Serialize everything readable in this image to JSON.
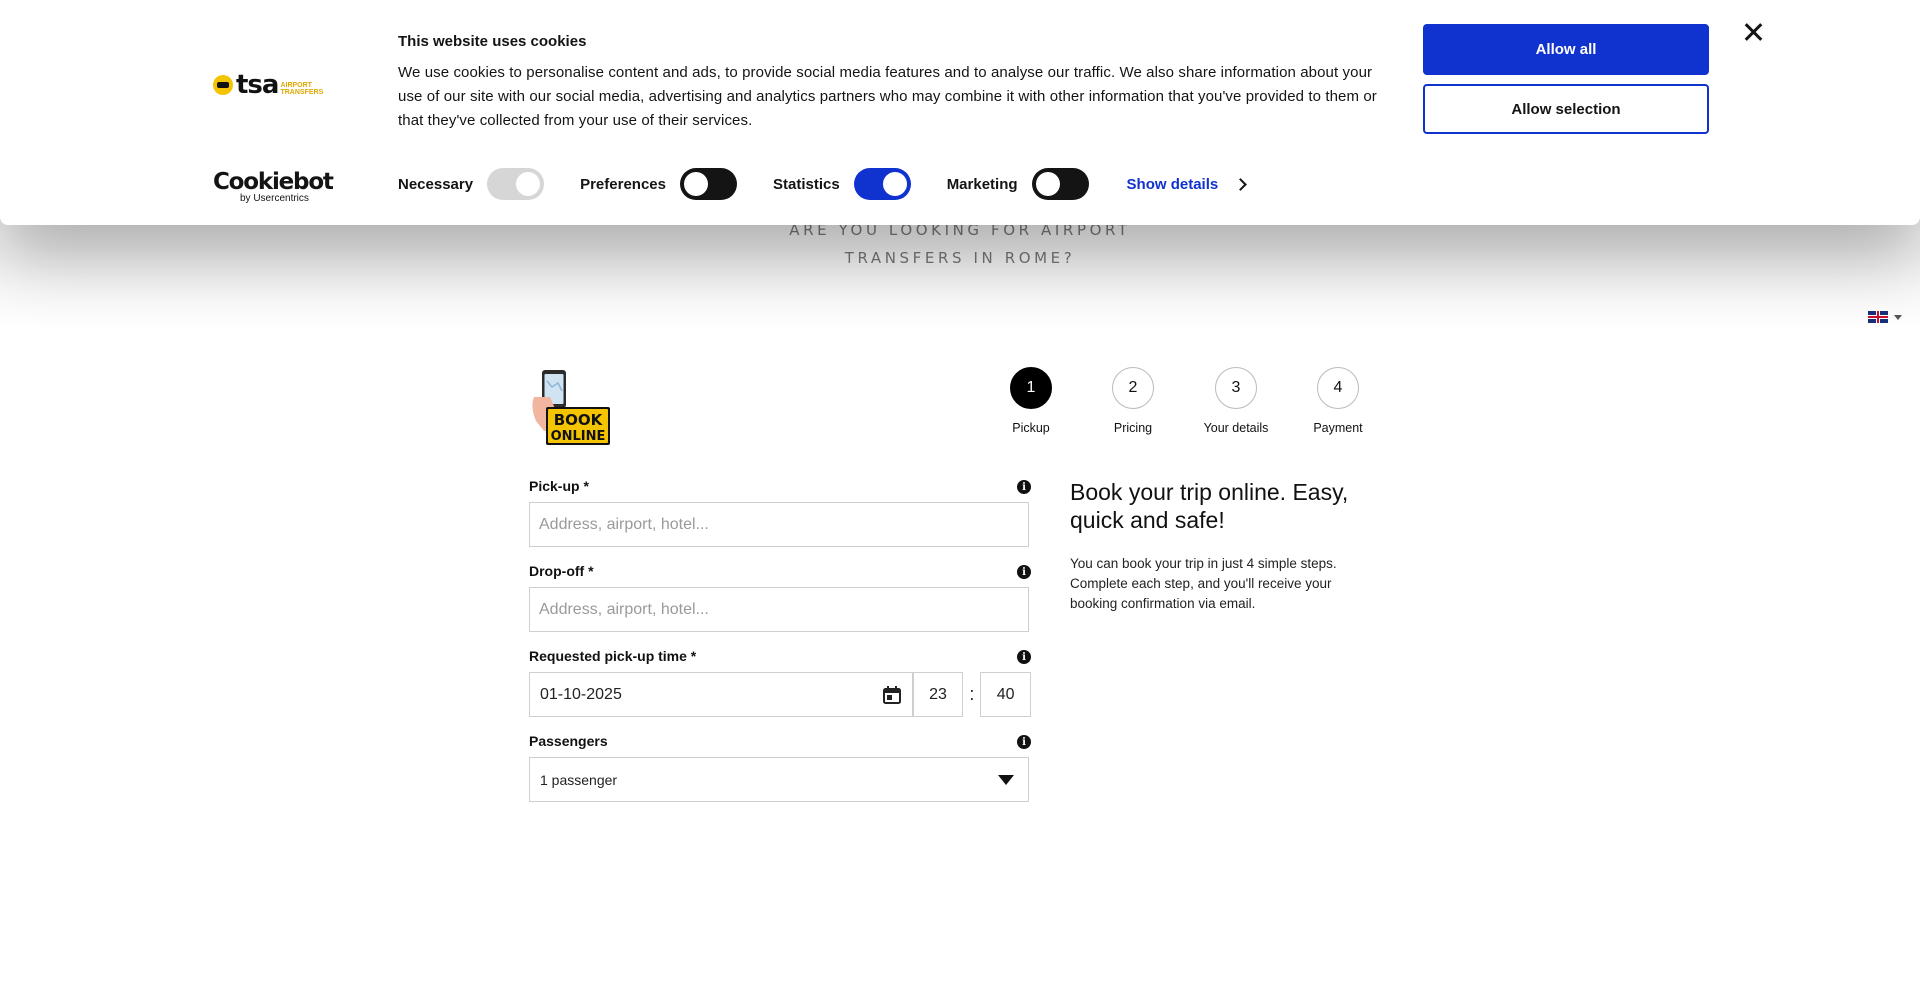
{
  "cookie_banner": {
    "title": "This website uses cookies",
    "text": "We use cookies to personalise content and ads, to provide social media features and to analyse our traffic. We also share information about your use of our site with our social media, advertising and analytics partners who may combine it with other information that you've provided to them or that they've collected from your use of their services.",
    "toggles": [
      {
        "label": "Necessary",
        "state": "on-disabled"
      },
      {
        "label": "Preferences",
        "state": "off"
      },
      {
        "label": "Statistics",
        "state": "on"
      },
      {
        "label": "Marketing",
        "state": "off"
      }
    ],
    "show_details_label": "Show details",
    "allow_all_label": "Allow all",
    "allow_selection_label": "Allow selection",
    "brand_logo_text": "tsa",
    "brand_logo_sub": "AIRPORT TRANSFERS",
    "cookiebot_logo_text": "Cookiebot",
    "cookiebot_sub": "by Usercentrics",
    "accent_color": "#1032cf"
  },
  "hero": {
    "line1": "ARE YOU LOOKING FOR AIRPORT",
    "line2": "TRANSFERS IN ROME?"
  },
  "language": {
    "selected": "English",
    "icon": "uk-flag-icon"
  },
  "book_badge": {
    "line1": "BOOK",
    "line2": "ONLINE"
  },
  "steps": [
    {
      "number": "1",
      "label": "Pickup",
      "active": true
    },
    {
      "number": "2",
      "label": "Pricing",
      "active": false
    },
    {
      "number": "3",
      "label": "Your details",
      "active": false
    },
    {
      "number": "4",
      "label": "Payment",
      "active": false
    }
  ],
  "form": {
    "pickup": {
      "label": "Pick-up *",
      "placeholder": "Address, airport, hotel..."
    },
    "dropoff": {
      "label": "Drop-off *",
      "placeholder": "Address, airport, hotel..."
    },
    "pickup_time": {
      "label": "Requested pick-up time *",
      "date": "01-10-2025",
      "hour": "23",
      "separator": ":",
      "minute": "40"
    },
    "passengers": {
      "label": "Passengers",
      "value": "1 passenger"
    }
  },
  "info_panel": {
    "title": "Book your trip online. Easy, quick and safe!",
    "text": "You can book your trip in just 4 simple steps. Complete each step, and you'll receive your booking confirmation via email."
  }
}
